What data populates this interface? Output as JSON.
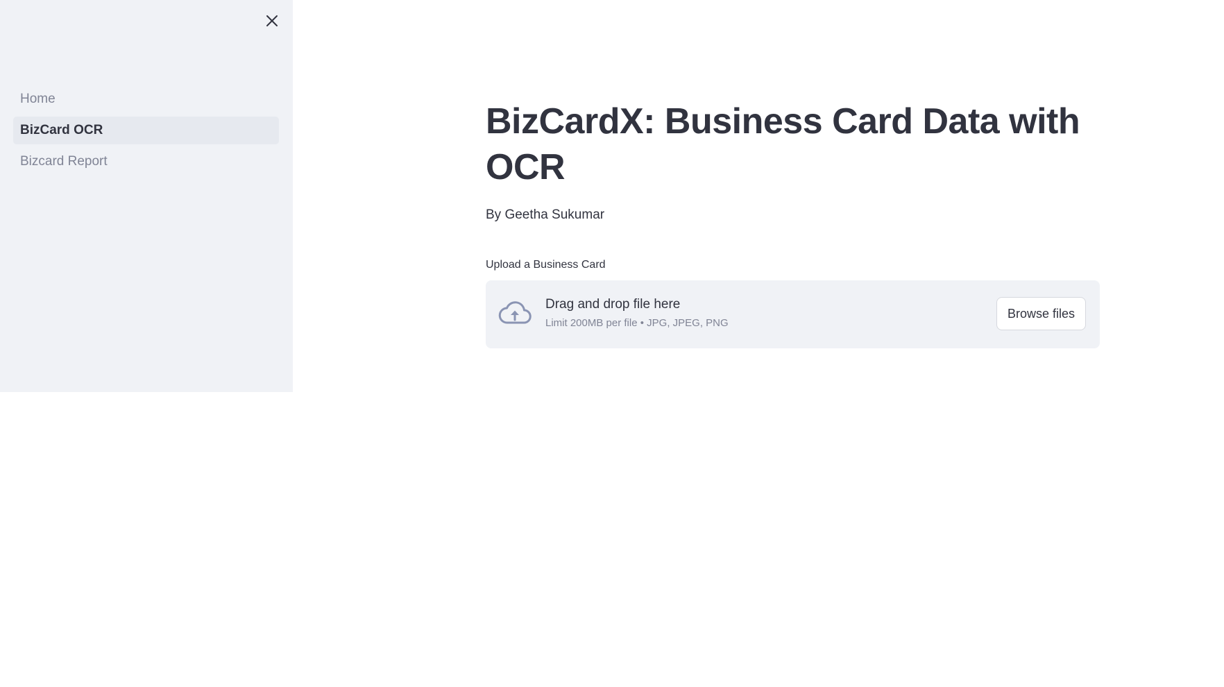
{
  "sidebar": {
    "items": [
      {
        "label": "Home",
        "active": false
      },
      {
        "label": "BizCard OCR",
        "active": true
      },
      {
        "label": "Bizcard Report",
        "active": false
      }
    ],
    "close_icon": "close-icon"
  },
  "main": {
    "title": "BizCardX: Business Card Data with OCR",
    "byline": "By Geetha Sukumar",
    "uploader": {
      "label": "Upload a Business Card",
      "drag_text": "Drag and drop file here",
      "limit_text": "Limit 200MB per file • JPG, JPEG, PNG",
      "browse_label": "Browse files",
      "icon": "cloud-upload-icon"
    }
  },
  "colors": {
    "sidebar_bg": "#f0f2f6",
    "active_item_bg": "#e6e9ef",
    "text_primary": "#31333f",
    "text_muted": "#808495",
    "icon_color": "#8a94b3"
  }
}
